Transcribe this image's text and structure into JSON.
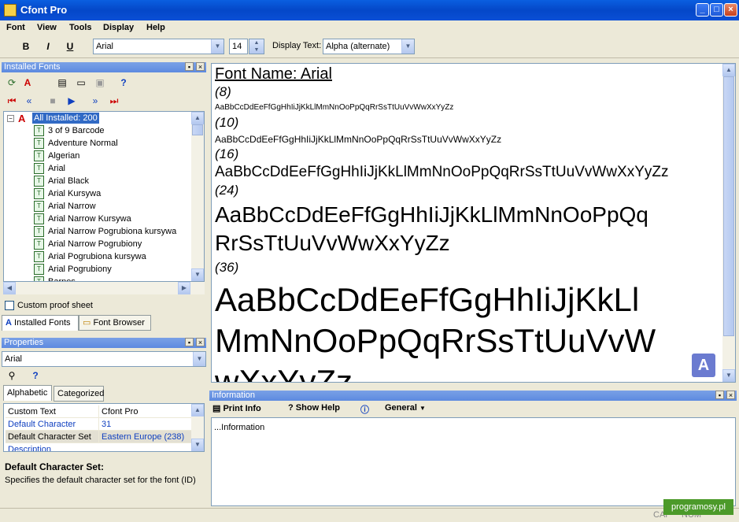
{
  "window": {
    "title": "Cfont Pro"
  },
  "menu": [
    "Font",
    "View",
    "Tools",
    "Display",
    "Help"
  ],
  "toolbar": {
    "bold": "B",
    "italic": "I",
    "underline": "U",
    "font_combo": "Arial",
    "size_value": "14",
    "display_text_label": "Display Text:",
    "display_text_value": "Alpha (alternate)"
  },
  "installed_fonts": {
    "header": "Installed Fonts",
    "root": "All Installed: 200",
    "items": [
      "3 of 9 Barcode",
      "Adventure Normal",
      "Algerian",
      "Arial",
      "Arial Black",
      "Arial Kursywa",
      "Arial Narrow",
      "Arial Narrow Kursywa",
      "Arial Narrow Pogrubiona kursywa",
      "Arial Narrow Pogrubiony",
      "Arial Pogrubiona kursywa",
      "Arial Pogrubiony",
      "Barnes"
    ],
    "custom_proof": "Custom proof sheet",
    "tab_installed": "Installed Fonts",
    "tab_browser": "Font Browser"
  },
  "properties": {
    "header": "Properties",
    "object": "Arial",
    "tab_alpha": "Alphabetic",
    "tab_cat": "Categorized",
    "rows": [
      {
        "name": "Custom Text",
        "value": "Cfont Pro"
      },
      {
        "name": "Default Character",
        "value": "31"
      },
      {
        "name": "Default Character Set",
        "value": "Eastern Europe (238)"
      },
      {
        "name": "Description",
        "value": ""
      }
    ],
    "desc_title": "Default Character Set:",
    "desc_text": "Specifies the default character set for the font (ID)"
  },
  "preview": {
    "font_name": "Font Name: Arial",
    "s8": "(8)",
    "t8": "AaBbCcDdEeFfGgHhIiJjKkLlMmNnOoPpQqRrSsTtUuVvWwXxYyZz",
    "s10": "(10)",
    "t10": "AaBbCcDdEeFfGgHhIiJjKkLlMmNnOoPpQqRrSsTtUuVvWwXxYyZz",
    "s16": "(16)",
    "t16": "AaBbCcDdEeFfGgHhIiJjKkLlMmNnOoPpQqRrSsTtUuVvWwXxYyZz",
    "s24": "(24)",
    "t24a": "AaBbCcDdEeFfGgHhIiJjKkLlMmNnOoPpQq",
    "t24b": "RrSsTtUuVvWwXxYyZz",
    "s36": "(36)",
    "t36a": "AaBbCcDdEeFfGgHhIiJjKkLl",
    "t36b": "MmNnOoPpQqRrSsTtUuVvW",
    "t36c": "wXxYyZz"
  },
  "information": {
    "header": "Information",
    "print_info": "Print Info",
    "show_help": "Show Help",
    "general": "General",
    "body": "...Information"
  },
  "status": {
    "cap": "CAP",
    "num": "NUM"
  },
  "watermark": "programosy.pl",
  "colors": {
    "titlebar": "#0a5fe0",
    "panelhead": "#7aa1e6",
    "selection": "#316ac5"
  }
}
